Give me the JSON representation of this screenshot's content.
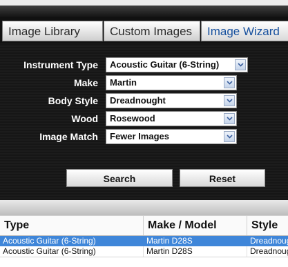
{
  "tabs": [
    {
      "label": "Image Library"
    },
    {
      "label": "Custom Images"
    },
    {
      "label": "Image Wizard"
    }
  ],
  "form": {
    "fields": [
      {
        "label": "Instrument Type",
        "value": "Acoustic Guitar (6-String)"
      },
      {
        "label": "Make",
        "value": "Martin"
      },
      {
        "label": "Body Style",
        "value": "Dreadnought"
      },
      {
        "label": "Wood",
        "value": "Rosewood"
      },
      {
        "label": "Image Match",
        "value": "Fewer Images"
      }
    ],
    "search_label": "Search",
    "reset_label": "Reset"
  },
  "results": {
    "columns": [
      "Type",
      "Make / Model",
      "Style"
    ],
    "rows": [
      {
        "type": "Acoustic Guitar (6-String)",
        "make_model": "Martin D28S",
        "style": "Dreadnought",
        "selected": true
      },
      {
        "type": "Acoustic Guitar (6-String)",
        "make_model": "Martin D28S",
        "style": "Dreadnought",
        "selected": false
      }
    ]
  },
  "colors": {
    "active_tab_text": "#16509e",
    "selected_row": "#3f86d9",
    "panel_background": "#181818"
  },
  "icons": {
    "dropdown": "chevron-down-icon"
  }
}
